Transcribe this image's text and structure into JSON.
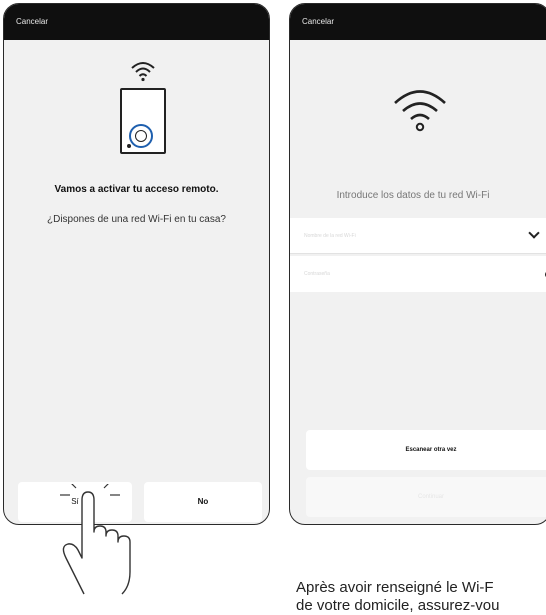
{
  "left_screen": {
    "cancel_label": "Cancelar",
    "heading": "Vamos a activar tu acceso remoto.",
    "question": "¿Dispones de una red Wi-Fi en tu casa?",
    "buttons": {
      "yes": "Sí",
      "no": "No"
    }
  },
  "right_screen": {
    "cancel_label": "Cancelar",
    "prompt": "Introduce los datos de tu red Wi-Fi",
    "network_placeholder": "Nombre de la red Wi-Fi",
    "password_placeholder": "Contraseña",
    "scan_again_label": "Escanear otra vez",
    "continue_label": "Continuar"
  },
  "caption": {
    "line1": "Après avoir renseigné le Wi-F",
    "line2": "de votre domicile, assurez-vou"
  },
  "colors": {
    "topbar": "#0f0f0f",
    "accent": "#1e5fae",
    "screen_bg": "#f1f1f1"
  },
  "icons": [
    "wifi-icon",
    "smart-plug-icon",
    "chevron-down-icon",
    "eye-icon",
    "tapping-hand-icon"
  ]
}
